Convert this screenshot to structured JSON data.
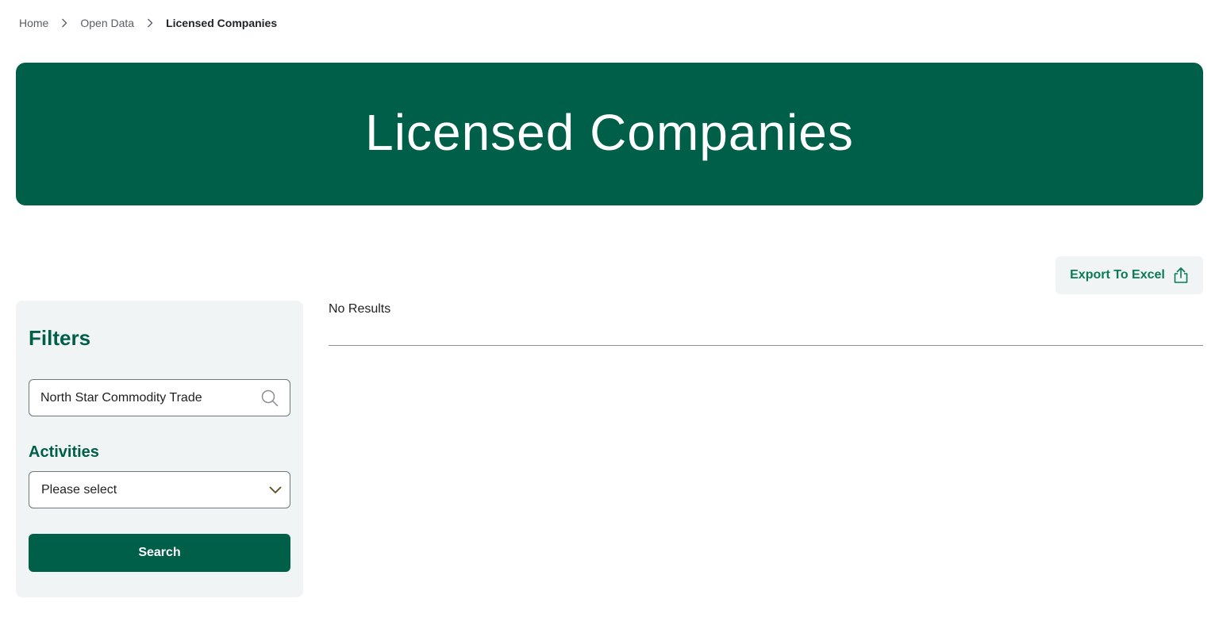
{
  "breadcrumb": {
    "items": [
      "Home",
      "Open Data"
    ],
    "current": "Licensed Companies"
  },
  "hero": {
    "title": "Licensed Companies"
  },
  "toolbar": {
    "export_label": "Export To Excel"
  },
  "filters": {
    "title": "Filters",
    "search": {
      "value": "North Star Commodity Trade"
    },
    "activities": {
      "label": "Activities",
      "selected": "Please select"
    },
    "search_button_label": "Search"
  },
  "results": {
    "status": "No Results"
  },
  "colors": {
    "brand_green": "#005f49",
    "accent_green": "#0a7a55",
    "panel_bg": "#f1f4f4"
  },
  "icons": {
    "export": "share-upload-icon",
    "search": "search-icon",
    "dropdown": "chevron-down-icon",
    "separator": "chevron-right-icon"
  }
}
